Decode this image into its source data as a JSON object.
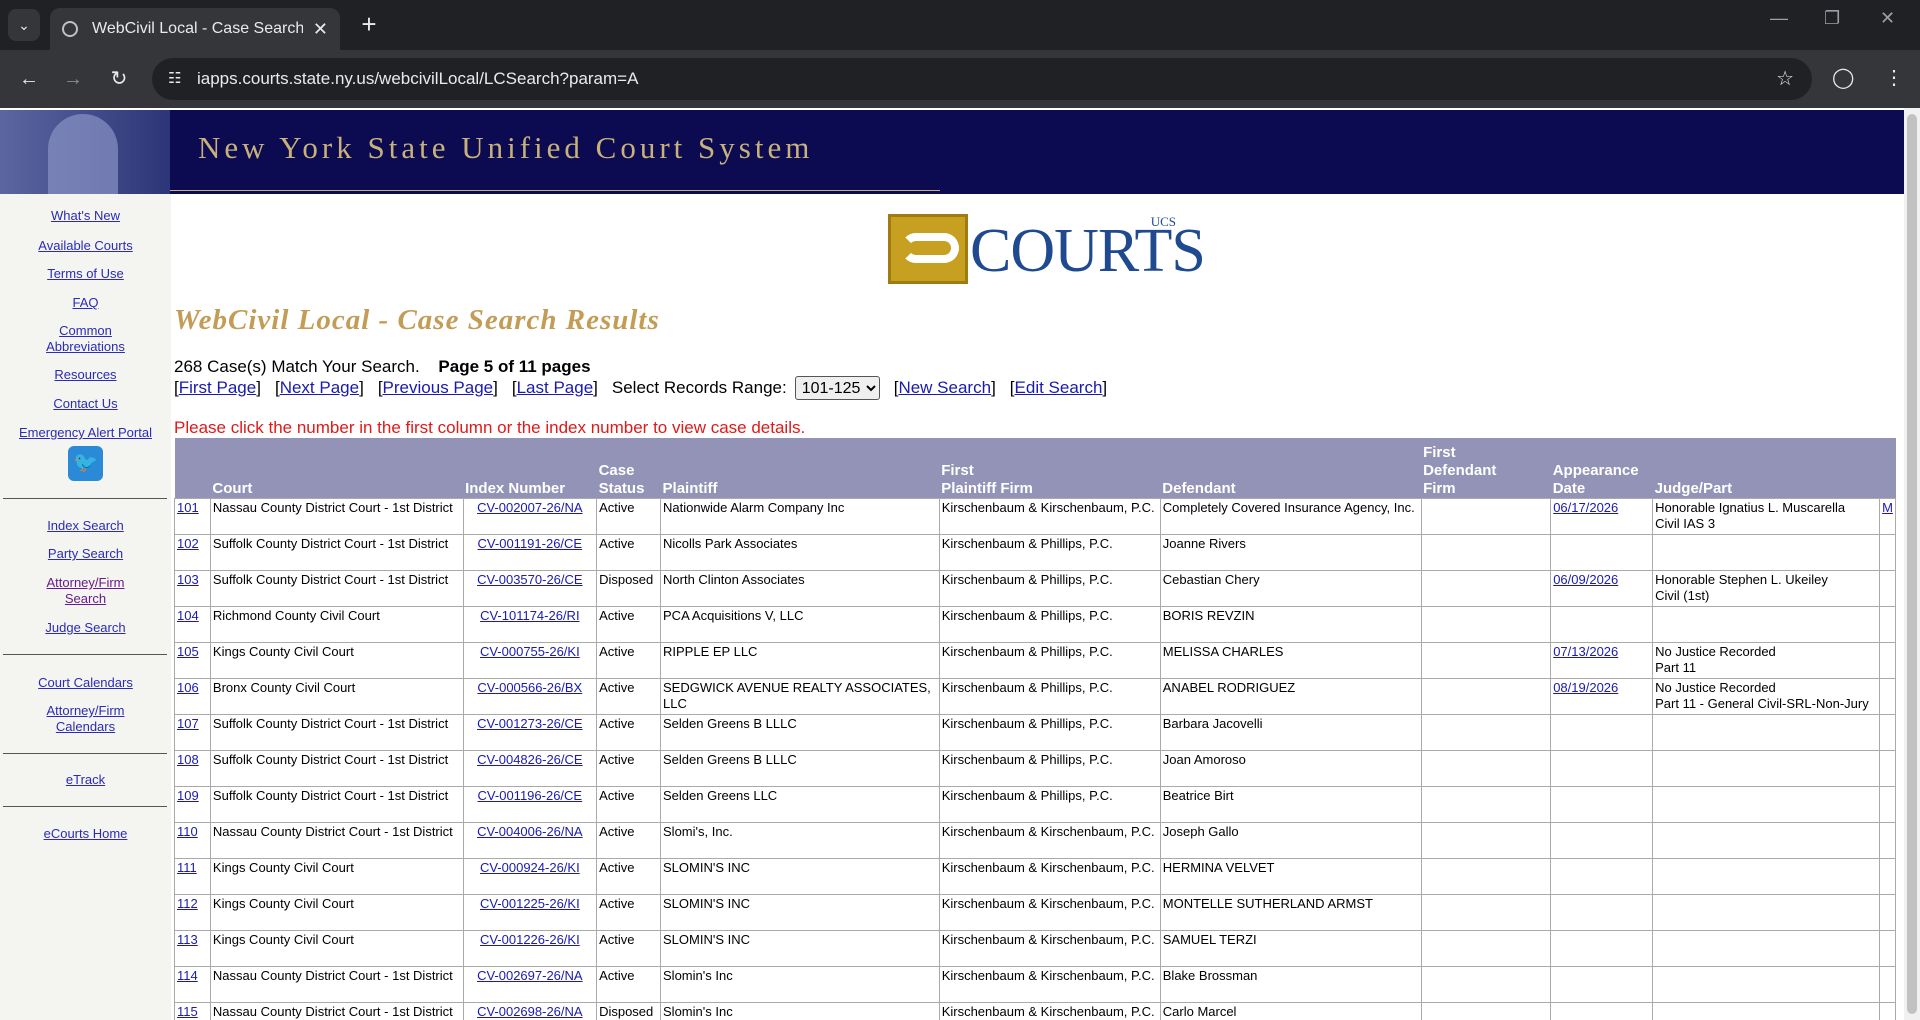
{
  "browser": {
    "tab_title": "WebCivil Local - Case Search Re",
    "url": "iapps.courts.state.ny.us/webcivilLocal/LCSearch?param=A"
  },
  "banner": {
    "title": "New York State Unified Court System"
  },
  "sidebar": {
    "top_links": [
      "What's New",
      "Available Courts",
      "Terms of Use",
      "FAQ",
      "Common Abbreviations",
      "Resources",
      "Contact Us",
      "Emergency Alert Portal"
    ],
    "search_links": [
      "Index Search",
      "Party Search",
      "Attorney/Firm Search",
      "Judge Search"
    ],
    "calendar_links": [
      "Court Calendars",
      "Attorney/Firm Calendars"
    ],
    "etrack": "eTrack",
    "ecourts": "eCourts Home"
  },
  "logo": {
    "word": "COURTS",
    "small": "UCS"
  },
  "results": {
    "title": "WebCivil Local - Case Search Results",
    "summary": "268 Case(s) Match Your Search.",
    "page_info": "Page 5 of 11 pages",
    "first_page": "First Page",
    "next_page": "Next Page",
    "previous_page": "Previous Page",
    "last_page": "Last Page",
    "range_label": "Select Records Range:",
    "range_value": "101-125",
    "new_search": "New Search",
    "edit_search": "Edit Search",
    "instruction": "Please click the number in the first column or the index number to view case details."
  },
  "table": {
    "headers": [
      "",
      "Court",
      "Index Number",
      "Case Status",
      "Plaintiff",
      "First Plaintiff Firm",
      "Defendant",
      "First Defendant Firm",
      "Appearance Date",
      "Judge/Part",
      ""
    ],
    "rows": [
      {
        "num": "101",
        "court": "Nassau County District Court - 1st District",
        "index": "CV-002007-26/NA",
        "status": "Active",
        "plaintiff": "Nationwide Alarm Company Inc",
        "pfirm": "Kirschenbaum & Kirschenbaum, P.C.",
        "defendant": "Completely Covered Insurance Agency, Inc.",
        "dfirm": "",
        "date": "06/17/2026",
        "judge": "Honorable Ignatius L. Muscarella",
        "part": "Civil IAS 3",
        "extra": "M"
      },
      {
        "num": "102",
        "court": "Suffolk County District Court - 1st District",
        "index": "CV-001191-26/CE",
        "status": "Active",
        "plaintiff": "Nicolls Park Associates",
        "pfirm": "Kirschenbaum & Phillips, P.C.",
        "defendant": "Joanne Rivers",
        "dfirm": "",
        "date": "",
        "judge": "",
        "part": "",
        "extra": ""
      },
      {
        "num": "103",
        "court": "Suffolk County District Court - 1st District",
        "index": "CV-003570-26/CE",
        "status": "Disposed",
        "plaintiff": "North Clinton Associates",
        "pfirm": "Kirschenbaum & Phillips, P.C.",
        "defendant": "Cebastian Chery",
        "dfirm": "",
        "date": "06/09/2026",
        "judge": "Honorable Stephen L. Ukeiley",
        "part": "Civil (1st)",
        "extra": ""
      },
      {
        "num": "104",
        "court": "Richmond County Civil Court",
        "index": "CV-101174-26/RI",
        "status": "Active",
        "plaintiff": "PCA Acquisitions V, LLC",
        "pfirm": "Kirschenbaum & Phillips, P.C.",
        "defendant": "BORIS REVZIN",
        "dfirm": "",
        "date": "",
        "judge": "",
        "part": "",
        "extra": ""
      },
      {
        "num": "105",
        "court": "Kings County Civil Court",
        "index": "CV-000755-26/KI",
        "status": "Active",
        "plaintiff": "RIPPLE EP LLC",
        "pfirm": "Kirschenbaum & Phillips, P.C.",
        "defendant": "MELISSA CHARLES",
        "dfirm": "",
        "date": "07/13/2026",
        "judge": "No Justice Recorded",
        "part": "Part 11",
        "extra": ""
      },
      {
        "num": "106",
        "court": "Bronx County Civil Court",
        "index": "CV-000566-26/BX",
        "status": "Active",
        "plaintiff": "SEDGWICK AVENUE REALTY ASSOCIATES, LLC",
        "pfirm": "Kirschenbaum & Phillips, P.C.",
        "defendant": "ANABEL RODRIGUEZ",
        "dfirm": "",
        "date": "08/19/2026",
        "judge": "No Justice Recorded",
        "part": "Part 11 - General Civil-SRL-Non-Jury",
        "extra": ""
      },
      {
        "num": "107",
        "court": "Suffolk County District Court - 1st District",
        "index": "CV-001273-26/CE",
        "status": "Active",
        "plaintiff": "Selden Greens B LLLC",
        "pfirm": "Kirschenbaum & Phillips, P.C.",
        "defendant": "Barbara Jacovelli",
        "dfirm": "",
        "date": "",
        "judge": "",
        "part": "",
        "extra": ""
      },
      {
        "num": "108",
        "court": "Suffolk County District Court - 1st District",
        "index": "CV-004826-26/CE",
        "status": "Active",
        "plaintiff": "Selden Greens B LLLC",
        "pfirm": "Kirschenbaum & Phillips, P.C.",
        "defendant": "Joan Amoroso",
        "dfirm": "",
        "date": "",
        "judge": "",
        "part": "",
        "extra": ""
      },
      {
        "num": "109",
        "court": "Suffolk County District Court - 1st District",
        "index": "CV-001196-26/CE",
        "status": "Active",
        "plaintiff": "Selden Greens LLC",
        "pfirm": "Kirschenbaum & Phillips, P.C.",
        "defendant": "Beatrice Birt",
        "dfirm": "",
        "date": "",
        "judge": "",
        "part": "",
        "extra": ""
      },
      {
        "num": "110",
        "court": "Nassau County District Court - 1st District",
        "index": "CV-004006-26/NA",
        "status": "Active",
        "plaintiff": "Slomi's, Inc.",
        "pfirm": "Kirschenbaum & Kirschenbaum, P.C.",
        "defendant": "Joseph Gallo",
        "dfirm": "",
        "date": "",
        "judge": "",
        "part": "",
        "extra": ""
      },
      {
        "num": "111",
        "court": "Kings County Civil Court",
        "index": "CV-000924-26/KI",
        "status": "Active",
        "plaintiff": "SLOMIN'S INC",
        "pfirm": "Kirschenbaum & Kirschenbaum, P.C.",
        "defendant": "HERMINA VELVET",
        "dfirm": "",
        "date": "",
        "judge": "",
        "part": "",
        "extra": ""
      },
      {
        "num": "112",
        "court": "Kings County Civil Court",
        "index": "CV-001225-26/KI",
        "status": "Active",
        "plaintiff": "SLOMIN'S INC",
        "pfirm": "Kirschenbaum & Kirschenbaum, P.C.",
        "defendant": "MONTELLE SUTHERLAND ARMST",
        "dfirm": "",
        "date": "",
        "judge": "",
        "part": "",
        "extra": ""
      },
      {
        "num": "113",
        "court": "Kings County Civil Court",
        "index": "CV-001226-26/KI",
        "status": "Active",
        "plaintiff": "SLOMIN'S INC",
        "pfirm": "Kirschenbaum & Kirschenbaum, P.C.",
        "defendant": "SAMUEL TERZI",
        "dfirm": "",
        "date": "",
        "judge": "",
        "part": "",
        "extra": ""
      },
      {
        "num": "114",
        "court": "Nassau County District Court - 1st District",
        "index": "CV-002697-26/NA",
        "status": "Active",
        "plaintiff": "Slomin's Inc",
        "pfirm": "Kirschenbaum & Kirschenbaum, P.C.",
        "defendant": "Blake Brossman",
        "dfirm": "",
        "date": "",
        "judge": "",
        "part": "",
        "extra": ""
      },
      {
        "num": "115",
        "court": "Nassau County District Court - 1st District",
        "index": "CV-002698-26/NA",
        "status": "Disposed",
        "plaintiff": "Slomin's Inc",
        "pfirm": "Kirschenbaum & Kirschenbaum, P.C.",
        "defendant": "Carlo Marcel",
        "dfirm": "",
        "date": "",
        "judge": "",
        "part": "",
        "extra": ""
      }
    ]
  }
}
